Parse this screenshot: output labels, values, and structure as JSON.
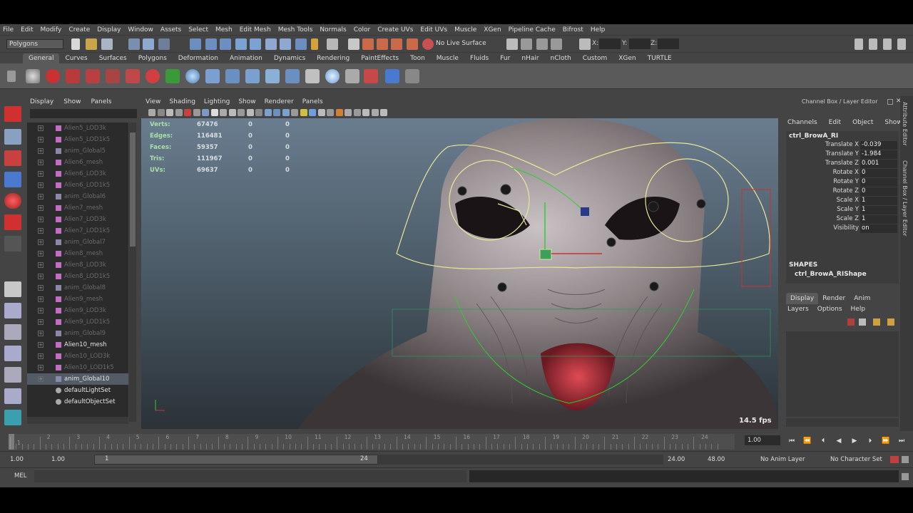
{
  "menubar": [
    "File",
    "Edit",
    "Modify",
    "Create",
    "Display",
    "Window",
    "Assets",
    "Select",
    "Mesh",
    "Edit Mesh",
    "Mesh Tools",
    "Normals",
    "Color",
    "Create UVs",
    "Edit UVs",
    "Muscle",
    "XGen",
    "Pipeline Cache",
    "Bifrost",
    "Help"
  ],
  "statusline": {
    "mode": "Polygons",
    "live_surface": "No Live Surface",
    "x_label": "X:",
    "y_label": "Y:",
    "z_label": "Z:"
  },
  "shelf_tabs": [
    "General",
    "Curves",
    "Surfaces",
    "Polygons",
    "Deformation",
    "Animation",
    "Dynamics",
    "Rendering",
    "PaintEffects",
    "Toon",
    "Muscle",
    "Fluids",
    "Fur",
    "nHair",
    "nCloth",
    "Custom",
    "XGen",
    "TURTLE"
  ],
  "outliner": {
    "menu": [
      "Display",
      "Show",
      "Panels"
    ],
    "rows": [
      {
        "label": "Alien5_LOD3k",
        "type": "mesh",
        "style": "dim"
      },
      {
        "label": "Alien5_LOD1k5",
        "type": "mesh",
        "style": "dim"
      },
      {
        "label": "anim_Global5",
        "type": "curve",
        "style": "dim"
      },
      {
        "label": "Alien6_mesh",
        "type": "mesh",
        "style": "dim"
      },
      {
        "label": "Alien6_LOD3k",
        "type": "mesh",
        "style": "dim"
      },
      {
        "label": "Alien6_LOD1k5",
        "type": "mesh",
        "style": "dim"
      },
      {
        "label": "anim_Global6",
        "type": "curve",
        "style": "dim"
      },
      {
        "label": "Alien7_mesh",
        "type": "mesh",
        "style": "dim"
      },
      {
        "label": "Alien7_LOD3k",
        "type": "mesh",
        "style": "dim"
      },
      {
        "label": "Alien7_LOD1k5",
        "type": "mesh",
        "style": "dim"
      },
      {
        "label": "anim_Global7",
        "type": "curve",
        "style": "dim"
      },
      {
        "label": "Alien8_mesh",
        "type": "mesh",
        "style": "dim"
      },
      {
        "label": "Alien8_LOD3k",
        "type": "mesh",
        "style": "dim"
      },
      {
        "label": "Alien8_LOD1k5",
        "type": "mesh",
        "style": "dim"
      },
      {
        "label": "anim_Global8",
        "type": "curve",
        "style": "dim"
      },
      {
        "label": "Alien9_mesh",
        "type": "mesh",
        "style": "dim"
      },
      {
        "label": "Alien9_LOD3k",
        "type": "mesh",
        "style": "dim"
      },
      {
        "label": "Alien9_LOD1k5",
        "type": "mesh",
        "style": "dim"
      },
      {
        "label": "anim_Global9",
        "type": "curve",
        "style": "dim"
      },
      {
        "label": "Alien10_mesh",
        "type": "mesh",
        "style": "bright"
      },
      {
        "label": "Alien10_LOD3k",
        "type": "mesh",
        "style": "dim"
      },
      {
        "label": "Alien10_LOD1k5",
        "type": "mesh",
        "style": "dim"
      },
      {
        "label": "anim_Global10",
        "type": "curve",
        "style": "sel"
      },
      {
        "label": "defaultLightSet",
        "type": "set",
        "style": "bright"
      },
      {
        "label": "defaultObjectSet",
        "type": "set",
        "style": "bright"
      }
    ]
  },
  "viewport": {
    "menu": [
      "View",
      "Shading",
      "Lighting",
      "Show",
      "Renderer",
      "Panels"
    ],
    "hud": [
      {
        "label": "Verts:",
        "v1": "67476",
        "v2": "0",
        "v3": "0"
      },
      {
        "label": "Edges:",
        "v1": "116481",
        "v2": "0",
        "v3": "0"
      },
      {
        "label": "Faces:",
        "v1": "59357",
        "v2": "0",
        "v3": "0"
      },
      {
        "label": "Tris:",
        "v1": "111967",
        "v2": "0",
        "v3": "0"
      },
      {
        "label": "UVs:",
        "v1": "69637",
        "v2": "0",
        "v3": "0"
      }
    ],
    "fps": "14.5 fps"
  },
  "channelbox": {
    "title": "Channel Box / Layer Editor",
    "menu": [
      "Channels",
      "Edit",
      "Object",
      "Show"
    ],
    "object": "ctrl_BrowA_RI",
    "attributes": [
      {
        "name": "Translate X",
        "value": "-0.039"
      },
      {
        "name": "Translate Y",
        "value": "-1.984"
      },
      {
        "name": "Translate Z",
        "value": "0.001"
      },
      {
        "name": "Rotate X",
        "value": "0"
      },
      {
        "name": "Rotate Y",
        "value": "0"
      },
      {
        "name": "Rotate Z",
        "value": "0"
      },
      {
        "name": "Scale X",
        "value": "1"
      },
      {
        "name": "Scale Y",
        "value": "1"
      },
      {
        "name": "Scale Z",
        "value": "1"
      },
      {
        "name": "Visibility",
        "value": "on"
      }
    ],
    "shapes_label": "SHAPES",
    "shape": "ctrl_BrowA_RIShape",
    "layer_tabs": [
      "Display",
      "Render",
      "Anim"
    ],
    "layer_menu": [
      "Layers",
      "Options",
      "Help"
    ]
  },
  "sidetabs": [
    "Attribute Editor",
    "Channel Box / Layer Editor"
  ],
  "timeline": {
    "ticks": [
      "1",
      "2",
      "3",
      "4",
      "5",
      "6",
      "7",
      "8",
      "9",
      "10",
      "11",
      "12",
      "13",
      "14",
      "15",
      "16",
      "17",
      "18",
      "19",
      "20",
      "21",
      "22",
      "23",
      "24"
    ],
    "current_frame": "1.00"
  },
  "range": {
    "start": "1.00",
    "playback_start": "1.00",
    "handle_start": "1",
    "handle_end": "24",
    "playback_end": "24.00",
    "end": "48.00",
    "anim_layer": "No Anim Layer",
    "char_set": "No Character Set"
  },
  "cmdline": {
    "label": "MEL"
  },
  "colors": {
    "maya_bg": "#444444",
    "panel_dark": "#2b2b2b",
    "selection": "#525b66",
    "accent_yellow": "#e8e69a",
    "accent_green": "#33cc33"
  }
}
